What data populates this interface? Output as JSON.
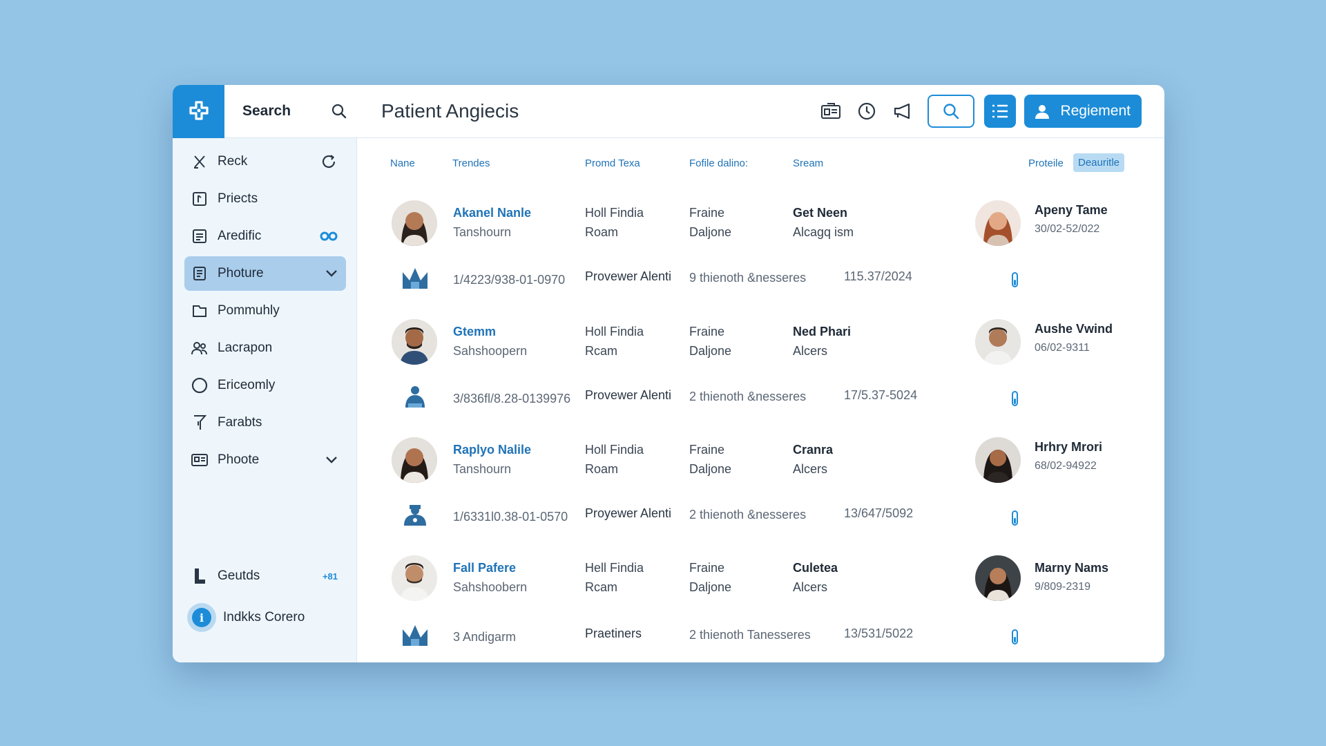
{
  "colors": {
    "accent": "#1c8cd8",
    "background": "#94c4e6",
    "sidebar": "#eef6fc",
    "active": "#aacdec"
  },
  "sidebar": {
    "logo_icon": "medical-cross-icon",
    "search_label": "Search",
    "items": [
      {
        "label": "Reck",
        "icon": "x-close-icon",
        "trail": "refresh-icon"
      },
      {
        "label": "Priects",
        "icon": "frame-icon"
      },
      {
        "label": "Aredific",
        "icon": "document-icon",
        "trail": "link-icon"
      },
      {
        "label": "Photure",
        "icon": "clipboard-icon",
        "trail": "chevron-down-icon"
      },
      {
        "label": "Pommuhly",
        "icon": "folder-icon"
      },
      {
        "label": "Lacrapon",
        "icon": "group-icon"
      },
      {
        "label": "Ericeomly",
        "icon": "circle-icon"
      },
      {
        "label": "Farabts",
        "icon": "filter-icon"
      },
      {
        "label": "Phoote",
        "icon": "card-icon",
        "trail": "chevron-down-icon"
      }
    ],
    "bottom": {
      "label": "Geutds",
      "badge": "+81",
      "user_name": "Indkks Corero"
    }
  },
  "header": {
    "title": "Patient Angiecis",
    "register_label": "Regiement"
  },
  "table": {
    "columns": [
      "Nane",
      "Trendes",
      "Promd Texa",
      "Fofile dalino:",
      "Sream",
      "Proteile"
    ],
    "pill": "Deauritle",
    "rows": [
      {
        "name": "Akanel Nanle",
        "sub": "Tanshourn",
        "c3a": "Holl Findia",
        "c3b": "Roam",
        "c4a": "Fraine",
        "c4b": "Daljone",
        "c5a": "Get Neen",
        "c5b": "Alcagq ism",
        "p_name": "Apeny Tame",
        "p_date": "30/02-52/022",
        "detail": {
          "id": "1/4223/938-01-0970",
          "provider": "Provewer Alenti",
          "note": "9 thienoth &nesseres",
          "date": "115.37/2024"
        }
      },
      {
        "name": "Gtemm",
        "sub": "Sahshoopern",
        "c3a": "Holl Findia",
        "c3b": "Rcam",
        "c4a": "Fraine",
        "c4b": "Daljone",
        "c5a": "Ned Phari",
        "c5b": "Alcers",
        "p_name": "Aushe Vwind",
        "p_date": "06/02-9311",
        "detail": {
          "id": "3/836fl/8.28-0139976",
          "provider": "Provewer Alenti",
          "note": "2 thienoth &nesseres",
          "date": "17/5.37-5024"
        }
      },
      {
        "name": "Raplyo Nalile",
        "sub": "Tanshourn",
        "c3a": "Holl Findia",
        "c3b": "Roam",
        "c4a": "Fraine",
        "c4b": "Daljone",
        "c5a": "Cranra",
        "c5b": "Alcers",
        "p_name": "Hrhry Mrori",
        "p_date": "68/02-94922",
        "detail": {
          "id": "1/6331l0.38-01-0570",
          "provider": "Proyewer Alenti",
          "note": "2 thienoth &nesseres",
          "date": "13/647/5092"
        }
      },
      {
        "name": "Fall Pafere",
        "sub": "Sahshoobern",
        "c3a": "Hell Findia",
        "c3b": "Rcam",
        "c4a": "Fraine",
        "c4b": "Daljone",
        "c5a": "Culetea",
        "c5b": "Alcers",
        "p_name": "Marny Nams",
        "p_date": "9/809-2319",
        "detail": {
          "id": "3 Andigarm",
          "provider": "Praetiners",
          "note": "2 thienoth Tanesseres",
          "date": "13/531/5022"
        }
      }
    ]
  }
}
